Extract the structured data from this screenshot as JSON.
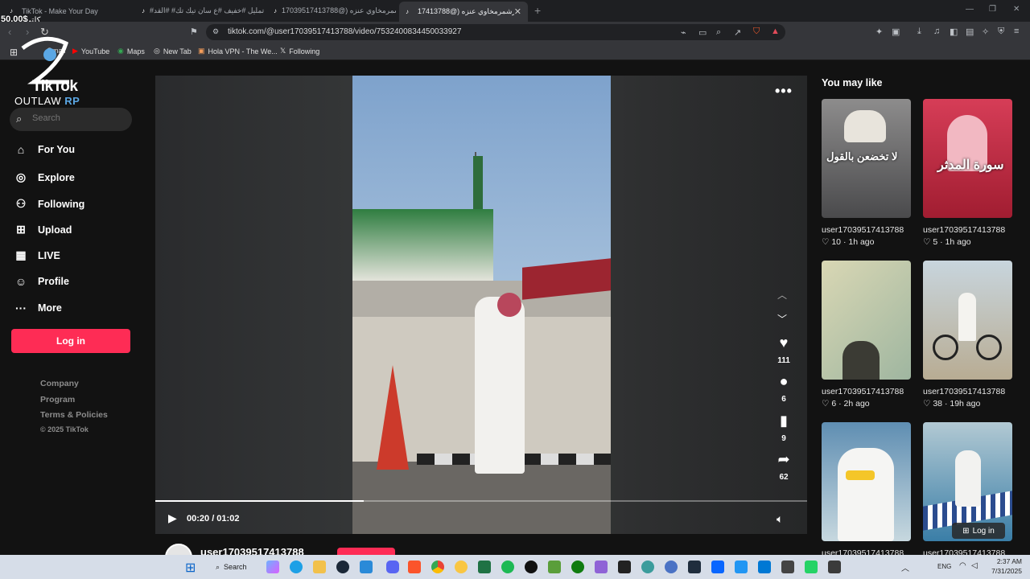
{
  "browser": {
    "tabs": [
      {
        "title": "TikTok - Make Your Day",
        "active": false
      },
      {
        "title": "#تمليل #خفيف #ع سان تيك تك# #القد...",
        "active": false
      },
      {
        "title": "صقرشمرمخاوي عنزه (@17039517413788...",
        "active": false
      },
      {
        "title": "صقرشمرمخاوي عنزه (@17413788...",
        "active": true
      }
    ],
    "url": "tiktok.com/@user17039517413788/video/7532400834450033927",
    "bookmarks": [
      "Gmail",
      "YouTube",
      "Maps",
      "New Tab",
      "Hola VPN - The We...",
      "Following"
    ]
  },
  "overlay": {
    "balance": "50.00$",
    "arabic": "كلتي"
  },
  "sidebar": {
    "brand": "TikTok",
    "brand_sub": "OUTLAW",
    "brand_sub_accent": "RP",
    "search_placeholder": "Search",
    "nav": [
      {
        "label": "For You",
        "icon": "home-icon"
      },
      {
        "label": "Explore",
        "icon": "compass-icon"
      },
      {
        "label": "Following",
        "icon": "following-icon"
      },
      {
        "label": "Upload",
        "icon": "upload-icon"
      },
      {
        "label": "LIVE",
        "icon": "live-icon"
      },
      {
        "label": "Profile",
        "icon": "profile-icon"
      },
      {
        "label": "More",
        "icon": "more-icon"
      }
    ],
    "login_label": "Log in",
    "footer": [
      "Company",
      "Program",
      "Terms & Policies"
    ],
    "copyright": "© 2025 TikTok"
  },
  "video": {
    "likes": "111",
    "comments": "6",
    "saves": "9",
    "shares": "62",
    "time": "00:20 / 01:02",
    "progress": 0.32,
    "author": "user17039517413788"
  },
  "recommendations": {
    "title": "You may like",
    "items": [
      {
        "user": "user17039517413788",
        "meta": "10 · 1h ago",
        "overlay": "لا تخضعن بالقول",
        "bg": "#6b6c6f"
      },
      {
        "user": "user17039517413788",
        "meta": "5 · 1h ago",
        "overlay": "سورة المدثر",
        "bg": "#b8283d"
      },
      {
        "user": "user17039517413788",
        "meta": "6 · 2h ago",
        "overlay": "",
        "bg": "#c8c7a0"
      },
      {
        "user": "user17039517413788",
        "meta": "38 · 19h ago",
        "overlay": "",
        "bg": "#cbbfa6"
      },
      {
        "user": "user17039517413788",
        "meta": "",
        "overlay": "",
        "bg": "#b9cfd9"
      },
      {
        "user": "user17039517413788",
        "meta": "",
        "overlay": "",
        "bg": "#6f8fa8"
      }
    ],
    "login_label": "Log in"
  },
  "taskbar": {
    "search_label": "Search",
    "lang": "ENG",
    "time": "2:37 AM",
    "date": "7/31/2025"
  }
}
